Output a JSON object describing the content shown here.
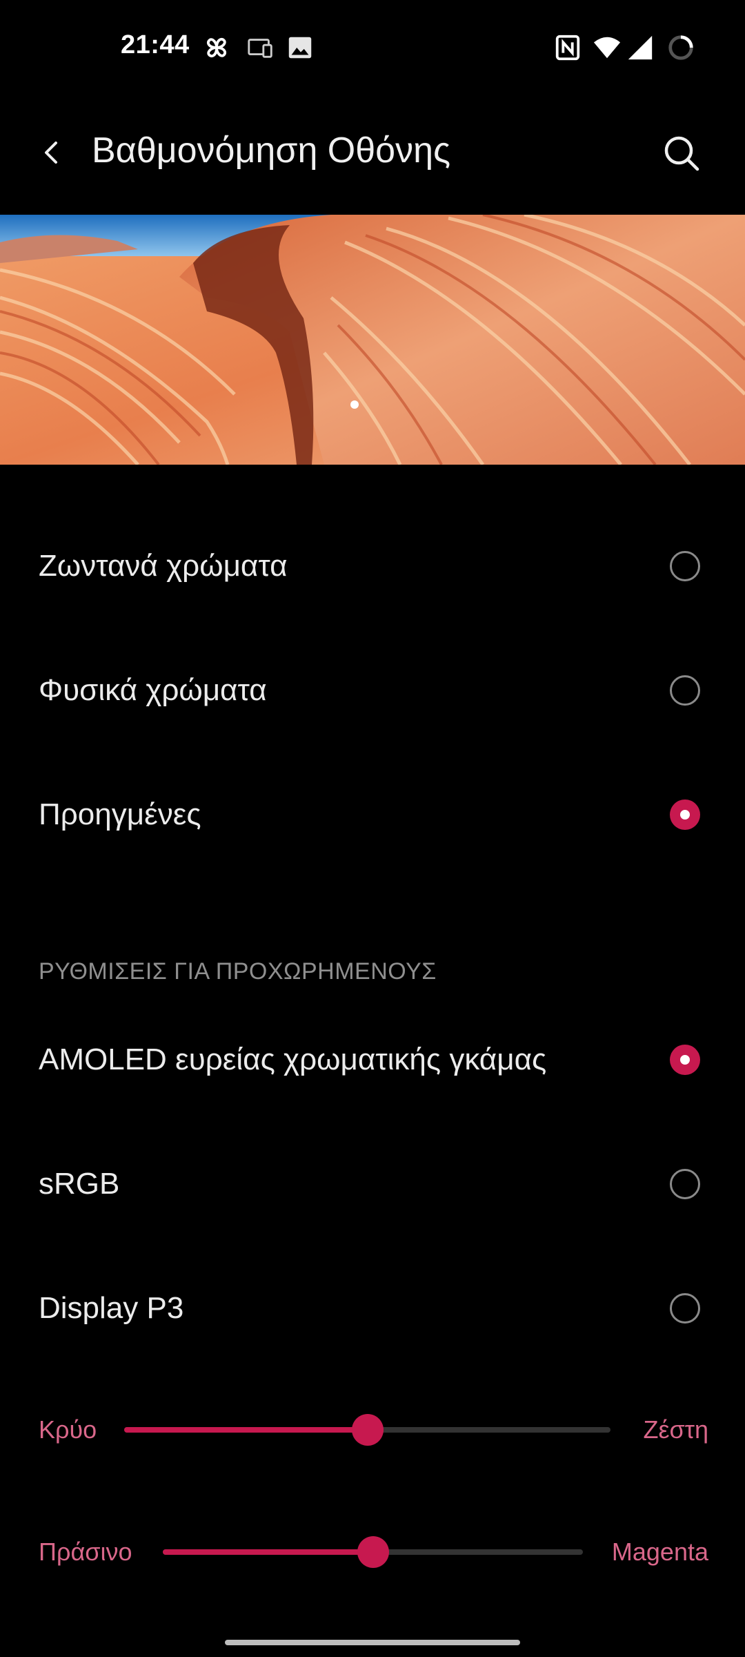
{
  "status_bar": {
    "time": "21:44",
    "icons": [
      "pinwheel-icon",
      "cast-icon",
      "gallery-icon",
      "nfc-icon",
      "wifi-icon",
      "signal-icon",
      "battery-saver-icon"
    ]
  },
  "app_bar": {
    "title": "Βαθμονόμηση Οθόνης",
    "back_icon": "back-arrow-icon",
    "search_icon": "search-icon"
  },
  "hero": {
    "image": "sandstone-wave-landscape",
    "pager_dots": 1
  },
  "display_modes": [
    {
      "label": "Ζωντανά χρώματα",
      "selected": false
    },
    {
      "label": "Φυσικά χρώματα",
      "selected": false
    },
    {
      "label": "Προηγμένες",
      "selected": true
    }
  ],
  "advanced_section": {
    "header": "ΡΥΘΜΙΣΕΙΣ ΓΙΑ ΠΡΟΧΩΡΗΜΕΝΟΥΣ",
    "options": [
      {
        "label": "AMOLED ευρείας χρωματικής γκάμας",
        "selected": true
      },
      {
        "label": "sRGB",
        "selected": false
      },
      {
        "label": "Display P3",
        "selected": false
      }
    ]
  },
  "sliders": [
    {
      "left_label": "Κρύο",
      "right_label": "Ζέστη",
      "value": 0.5
    },
    {
      "left_label": "Πράσινο",
      "right_label": "Magenta",
      "value": 0.5
    }
  ],
  "colors": {
    "accent": "#c7194f",
    "slider_label": "#d9678a",
    "background": "#000000"
  }
}
